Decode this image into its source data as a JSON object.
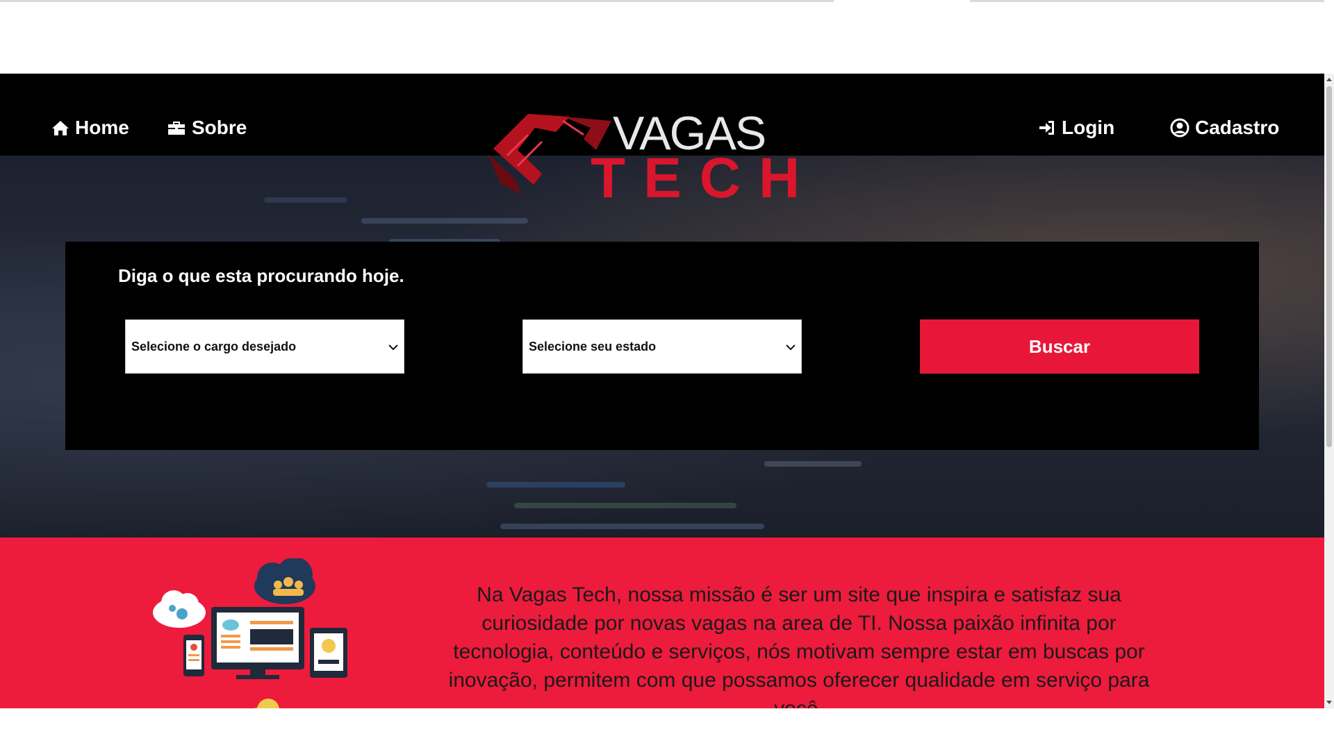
{
  "nav": {
    "home_label": "Home",
    "about_label": "Sobre",
    "login_label": "Login",
    "signup_label": "Cadastro",
    "icons": {
      "home": "home-icon",
      "about": "briefcase-icon",
      "login": "sign-in-icon",
      "signup": "user-circle-icon"
    }
  },
  "logo": {
    "line1": "VAGAS",
    "line2": "TECH"
  },
  "search": {
    "title": "Diga o que esta procurando hoje.",
    "cargo_select": "Selecione o cargo desejado",
    "estado_select": "Selecione seu estado",
    "button_label": "Buscar"
  },
  "mission": {
    "text": "Na Vagas Tech, nossa missão é ser um site que inspira e satisfaz sua curiosidade por novas vagas na area de TI. Nossa paixão infinita por tecnologia, conteúdo e serviços, nós motivam sempre estar em buscas por inovação, permitem com que possamos oferecer qualidade em serviço para você."
  },
  "colors": {
    "accent_red": "#e8173a",
    "section_red": "#ed1b3c",
    "logo_red": "#d9162d",
    "navbar_bg": "#000000"
  }
}
